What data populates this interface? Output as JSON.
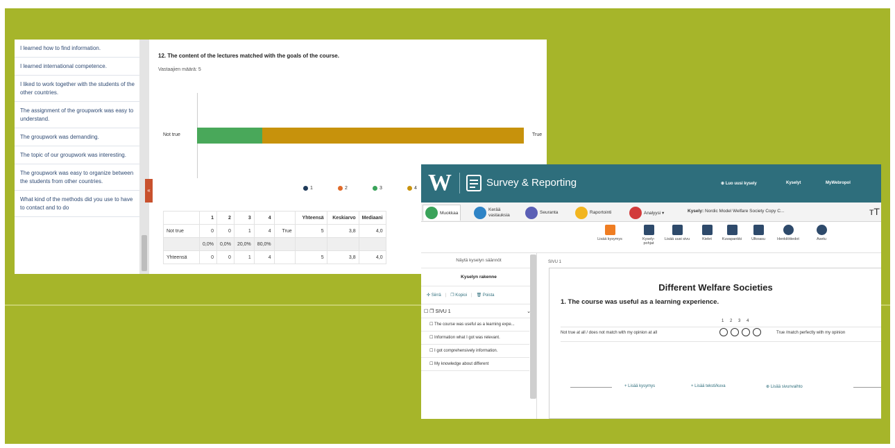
{
  "shot1": {
    "sidebar_items": [
      "I learned how to find information.",
      "I learned international competence.",
      "I liked to work together with the students of the other countries.",
      "The assignment of the groupwork was easy to understand.",
      "The groupwork was demanding.",
      "The topic of our groupwork was interesting.",
      "The groupwork was easy to organize between the students from other countries.",
      "What kind of the methods did you use to have to contact and to do"
    ],
    "collapse_tab": "«",
    "question": "12. The content of the lectures matched with the goals of the course.",
    "respondents": "Vastaajien määrä: 5",
    "scale_left": "Not true",
    "scale_right": "True",
    "legend": [
      {
        "label": "1",
        "color": "#1f3b5a"
      },
      {
        "label": "2",
        "color": "#e06b2a"
      },
      {
        "label": "3",
        "color": "#3aa35a"
      },
      {
        "label": "4",
        "color": "#c9930e"
      }
    ],
    "bar": [
      {
        "value": 1,
        "color": "#49a85a"
      },
      {
        "value": 4,
        "color": "#c7920c"
      }
    ],
    "table": {
      "headers": [
        "",
        "1",
        "2",
        "3",
        "4",
        "",
        "Yhteensä",
        "Keskiarvo",
        "Mediaani"
      ],
      "row1": [
        "Not true",
        "0",
        "0",
        "1",
        "4",
        "True",
        "5",
        "3,8",
        "4,0"
      ],
      "row2": [
        "",
        "0,0%",
        "0,0%",
        "20,0%",
        "80,0%",
        "",
        "",
        "",
        ""
      ],
      "row3": [
        "Yhteensä",
        "0",
        "0",
        "1",
        "4",
        "",
        "5",
        "3,8",
        "4,0"
      ]
    }
  },
  "shot2": {
    "logo": "W",
    "app_title": "Survey & Reporting",
    "topnav": [
      "⊕ Luo uusi kysely",
      "Kyselyt",
      "MyWebropol"
    ],
    "tabs": [
      "Muokkaa",
      "Kerää vastauksia",
      "Seuranta",
      "Raportointi",
      "Analyysi ▾"
    ],
    "kysely_label": "Kysely:",
    "kysely_name": "Nordic Model Welfare Society Copy C...",
    "text_size_icon": "ᴛT",
    "tools": [
      "Lisää kysymys",
      "Kysely-pohjat",
      "Lisää uusi sivu",
      "Kielet",
      "Kuvapankki",
      "Ulkoasu",
      "Henkilötiedot",
      "Asetu"
    ],
    "sidebar": {
      "show_settings": "Näytä kyselyn säännöt",
      "structure": "Kyselyn rakenne",
      "actions": [
        "✣ Siirrä",
        "❐ Kopioi",
        "🗑 Poista"
      ],
      "page": "SIVU 1",
      "items": [
        "The course was useful as a learning expe...",
        "Information what I got was relevant.",
        "I got comprehensively information.",
        "My knowledge about different"
      ]
    },
    "main": {
      "page_label": "SIVU 1",
      "survey_title": "Different Welfare Societies",
      "question": "1. The course was useful as a learning experience.",
      "scale_numbers": "1 2 3 4",
      "left_label": "Not true at all / does not match with my opinion at all",
      "right_label": "True /match perfectly with my opinion",
      "add_buttons": [
        "+ Lisää kysymys",
        "+ Lisää teksti/kuva",
        "⊕ Lisää sivunvaihto"
      ]
    }
  }
}
